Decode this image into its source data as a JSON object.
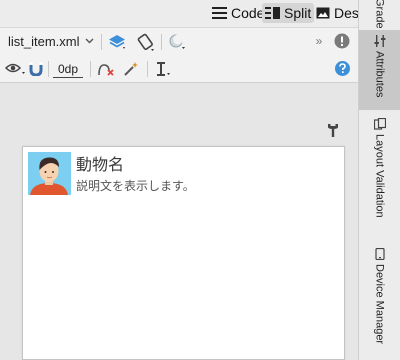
{
  "view_modes": {
    "code": "Code",
    "split": "Split",
    "design": "Design"
  },
  "toolbar": {
    "file_name": "list_item.xml",
    "margin_value": "0dp",
    "more": "»"
  },
  "side_tabs": {
    "grade": "Grade",
    "attributes": "Attributes",
    "layout_validation": "Layout Validation",
    "device_manager": "Device Manager"
  },
  "preview": {
    "item_title": "動物名",
    "item_description": "説明文を表示します。"
  },
  "colors": {
    "accent_blue": "#3c8fd9",
    "warning_red": "#e0443a",
    "avatar_bg": "#7ccff0"
  }
}
